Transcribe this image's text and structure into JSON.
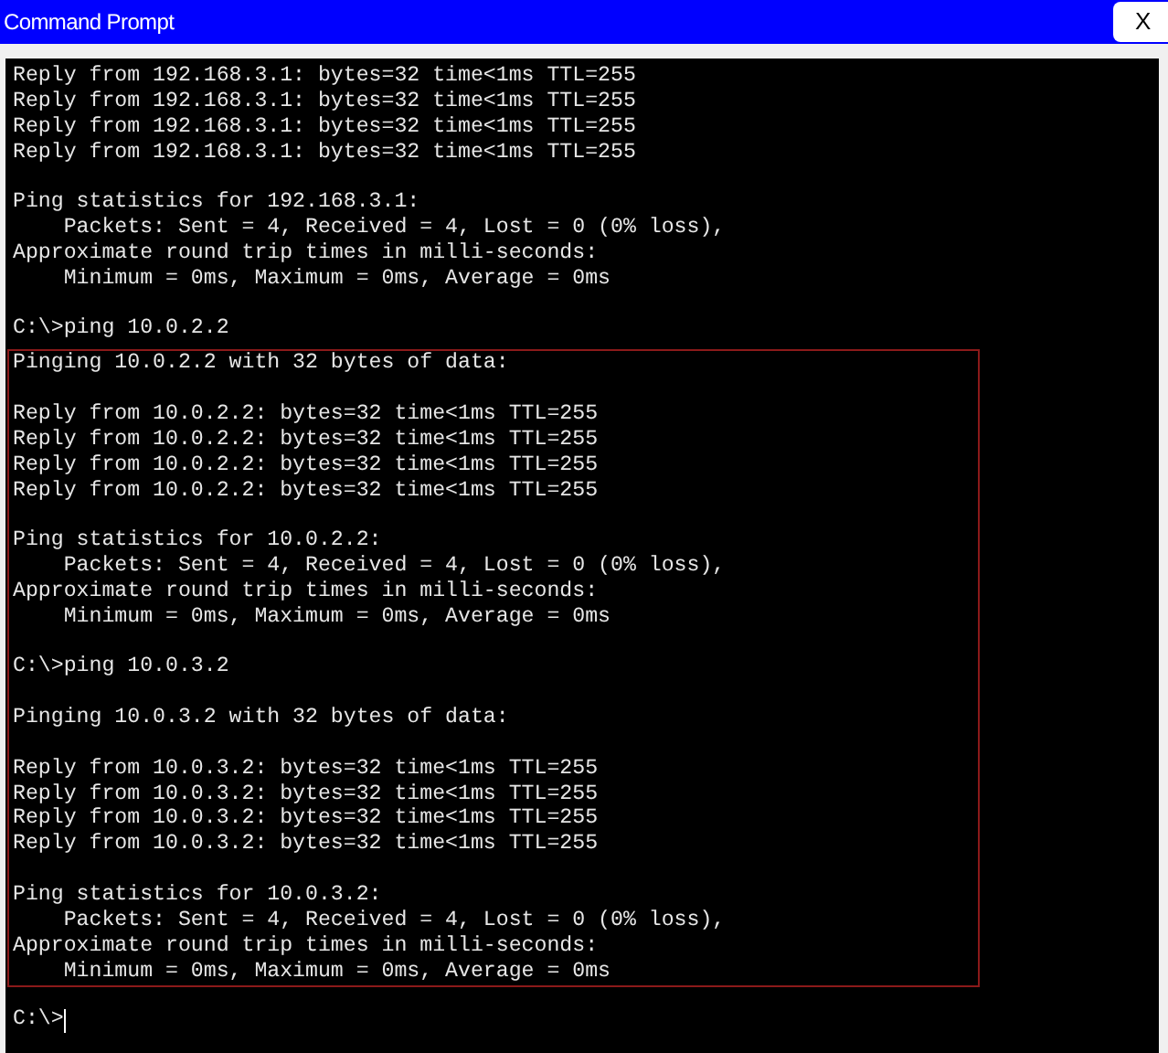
{
  "window": {
    "title": "Command Prompt",
    "close_label": "X"
  },
  "terminal": {
    "before": [
      [
        "Reply from 192.168.3.1: bytes=32 time<1ms TTL=255",
        "Reply from 192.168.3.1: bytes=32 time<1ms TTL=255",
        "Reply from 192.168.3.1: bytes=32 time<1ms TTL=255",
        "Reply from 192.168.3.1: bytes=32 time<1ms TTL=255"
      ],
      [
        "Ping statistics for 192.168.3.1:",
        "    Packets: Sent = 4, Received = 4, Lost = 0 (0% loss),",
        "Approximate round trip times in milli-seconds:",
        "    Minimum = 0ms, Maximum = 0ms, Average = 0ms"
      ],
      [
        "C:\\>ping 10.0.2.2"
      ]
    ],
    "highlighted": [
      [
        "Pinging 10.0.2.2 with 32 bytes of data:"
      ],
      [
        "Reply from 10.0.2.2: bytes=32 time<1ms TTL=255",
        "Reply from 10.0.2.2: bytes=32 time<1ms TTL=255",
        "Reply from 10.0.2.2: bytes=32 time<1ms TTL=255",
        "Reply from 10.0.2.2: bytes=32 time<1ms TTL=255"
      ],
      [
        "Ping statistics for 10.0.2.2:",
        "    Packets: Sent = 4, Received = 4, Lost = 0 (0% loss),",
        "Approximate round trip times in milli-seconds:",
        "    Minimum = 0ms, Maximum = 0ms, Average = 0ms"
      ],
      [
        "C:\\>ping 10.0.3.2"
      ],
      [
        "Pinging 10.0.3.2 with 32 bytes of data:"
      ],
      [
        "Reply from 10.0.3.2: bytes=32 time<1ms TTL=255",
        "Reply from 10.0.3.2: bytes=32 time<1ms TTL=255",
        "Reply from 10.0.3.2: bytes=32 time<1ms TTL=255",
        "Reply from 10.0.3.2: bytes=32 time<1ms TTL=255"
      ],
      [
        "Ping statistics for 10.0.3.2:",
        "    Packets: Sent = 4, Received = 4, Lost = 0 (0% loss),",
        "Approximate round trip times in milli-seconds:",
        "    Minimum = 0ms, Maximum = 0ms, Average = 0ms"
      ]
    ],
    "prompt": "C:\\>"
  }
}
